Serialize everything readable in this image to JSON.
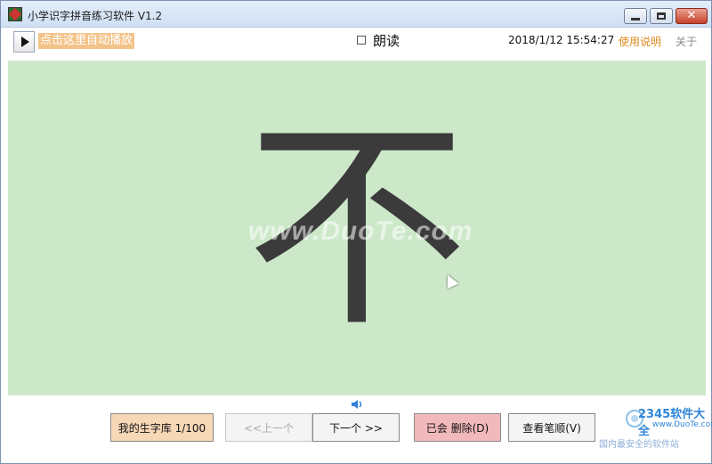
{
  "window": {
    "title": "小学识字拼音练习软件 V1.2",
    "close_glyph": "✕"
  },
  "toolbar": {
    "autoplay_label": "点击这里自动播放",
    "read_aloud_label": "朗读",
    "datetime": "2018/1/12 15:54:27",
    "help_label": "使用说明",
    "about_label": "关于"
  },
  "display": {
    "character": "不",
    "watermark": "www.DuoTe.com"
  },
  "bottom": {
    "library_label": "我的生字库 1/100",
    "prev_label": "<<上一个",
    "next_label": "下一个 >>",
    "delete_label": "已会 删除(D)",
    "stroke_label": "查看笔顺(V)",
    "logo_text": "2345软件大全",
    "logo_url": "www.DuoTe.com",
    "logo_sub": "国内最安全的软件站"
  },
  "colors": {
    "display_bg": "#cce8c9",
    "autoplay_bg": "#f4c38a",
    "library_btn_bg": "#f6d7b6",
    "delete_btn_bg": "#f2b9bd",
    "help_link": "#e08a1e"
  },
  "icons": {
    "app": "app-icon",
    "play": "play-icon",
    "speaker": "speaker-icon"
  }
}
